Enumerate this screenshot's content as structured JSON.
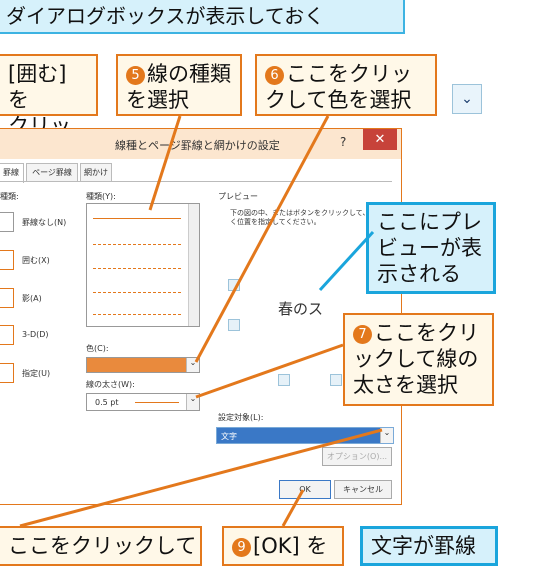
{
  "banner": {
    "text": "ダイアログボックスが表示しておく"
  },
  "callouts": {
    "c_left_top": "[囲む] を\nクリック",
    "c5_num": "5",
    "c5": "線の種類\nを選択",
    "c6_num": "6",
    "c6": "ここをクリッ\nクして色を選択",
    "preview_note": "ここにプレ\nビューが表\n示される",
    "c7_num": "7",
    "c7": "ここをクリ\nックして線の\n太さを選択",
    "c8": "ここをクリックして",
    "c9_num": "9",
    "c9": "[OK] を",
    "c10": "文字が罫線"
  },
  "dialog": {
    "title": "線種とページ罫線と網かけの設定",
    "help": "?",
    "close": "✕",
    "tabs": [
      "罫線",
      "ページ罫線",
      "網かけ"
    ],
    "settings_label": "種類:",
    "settings": [
      "罫線なし(N)",
      "囲む(X)",
      "影(A)",
      "3-D(D)",
      "指定(U)"
    ],
    "style_label": "種類(Y):",
    "color_label": "色(C):",
    "width_label": "線の太さ(W):",
    "width_value": "0.5 pt",
    "preview_label": "プレビュー",
    "preview_hint": "下の図の中、またはボタンをクリックして、罫線を引く位置を指定してください。",
    "preview_sample": "春のス",
    "apply_label": "設定対象(L):",
    "apply_value": "文字",
    "options_btn": "オプション(O)...",
    "ok_btn": "OK",
    "cancel_btn": "キャンセル"
  },
  "colors": {
    "accent_orange": "#e3781c",
    "accent_blue": "#1aa5dc",
    "line_color": "#e98a3d"
  }
}
